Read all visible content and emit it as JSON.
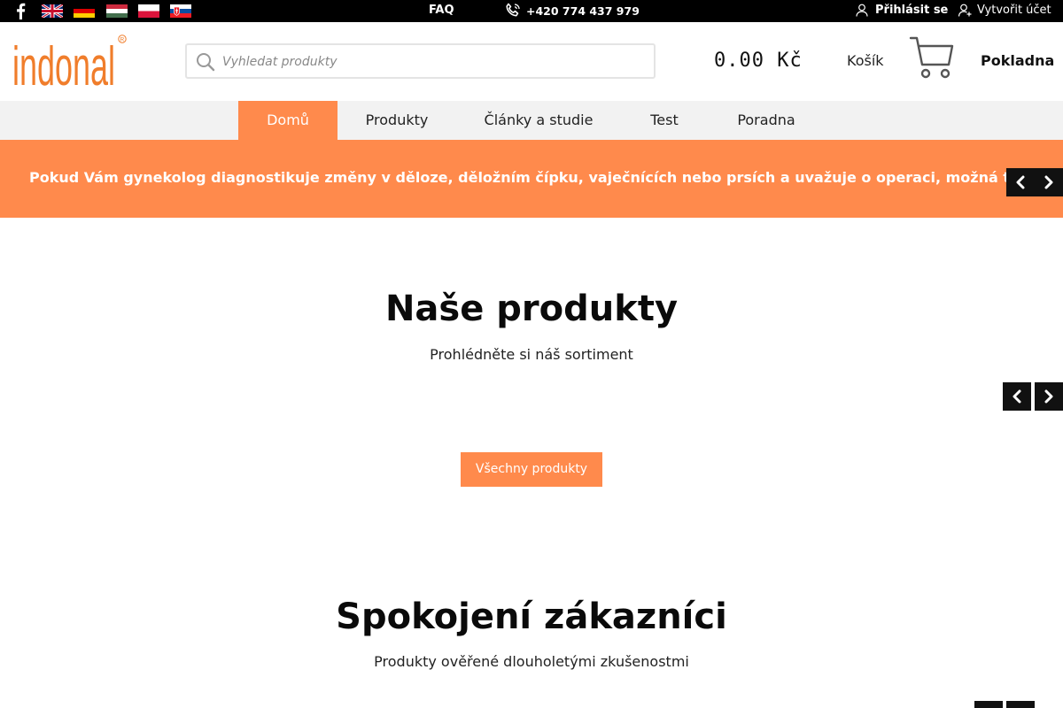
{
  "topbar": {
    "faq": "FAQ",
    "phone": "+420 774 437 979",
    "login": "Přihlásit se",
    "register": "Vytvořit účet",
    "flags": [
      "en",
      "de",
      "hu",
      "pl",
      "sk"
    ]
  },
  "header": {
    "logo_text": "indonal",
    "search_placeholder": "Vyhledat produkty",
    "cart_total": "0.00 Kč",
    "cart_label": "Košík",
    "checkout_label": "Pokladna"
  },
  "nav": {
    "items": [
      {
        "label": "Domů",
        "active": true
      },
      {
        "label": "Produkty",
        "active": false
      },
      {
        "label": "Články a studie",
        "active": false
      },
      {
        "label": "Test",
        "active": false
      },
      {
        "label": "Poradna",
        "active": false
      }
    ]
  },
  "banner": {
    "text": "Pokud Vám gynekolog diagnostikuje změny v děloze, děložním čípku, vaječnících nebo prsích a uvažuje o operaci, možná tomu zabránit."
  },
  "products_section": {
    "title": "Naše produkty",
    "subtitle": "Prohlédněte si náš sortiment",
    "button": "Všechny produkty"
  },
  "customers_section": {
    "title": "Spokojení zákazníci",
    "subtitle": "Produkty ověřené dlouholetými zkušenostmi"
  },
  "colors": {
    "accent": "#ff8a4c",
    "topbar": "#000000",
    "nav_bg": "#f2f2f2"
  }
}
